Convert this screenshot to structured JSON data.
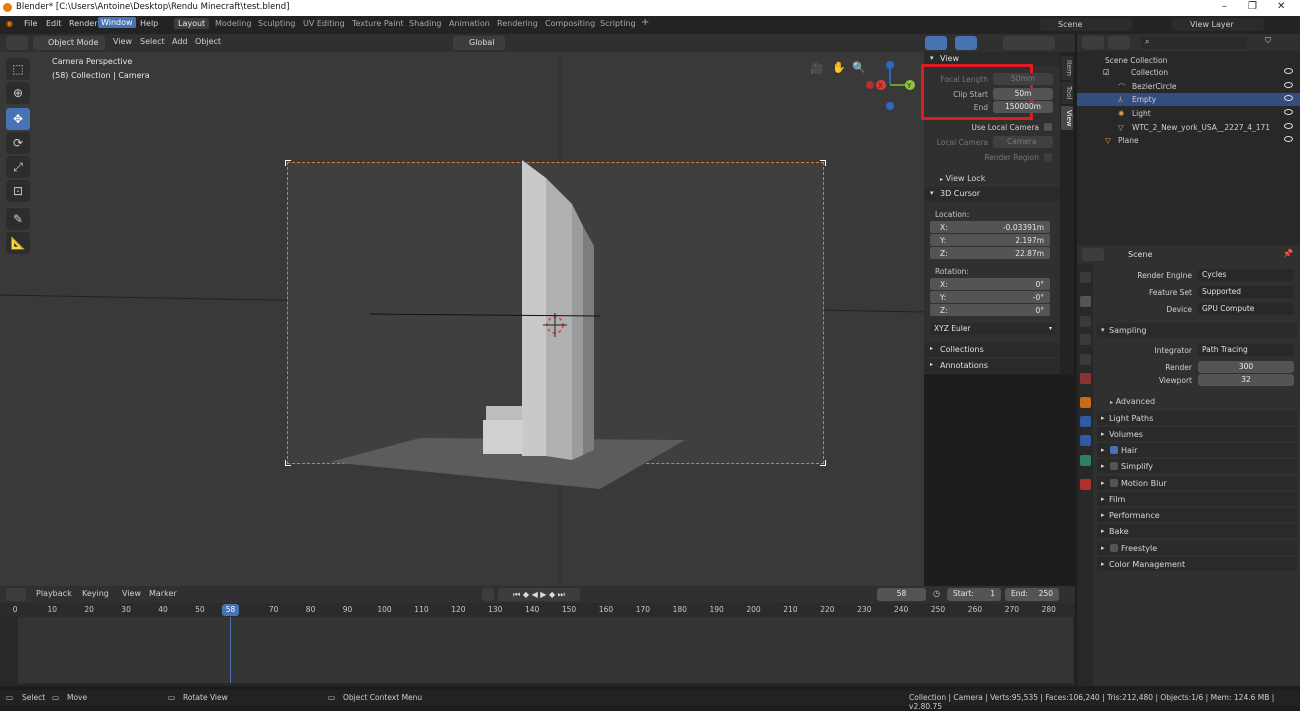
{
  "title": "Blender* [C:\\Users\\Antoine\\Desktop\\Rendu Minecraft\\test.blend]",
  "menu": [
    "File",
    "Edit",
    "Render",
    "Window",
    "Help"
  ],
  "menu_selected": "Window",
  "workspaces": [
    "Layout",
    "Modeling",
    "Sculpting",
    "UV Editing",
    "Texture Paint",
    "Shading",
    "Animation",
    "Rendering",
    "Compositing",
    "Scripting"
  ],
  "active_workspace": "Layout",
  "scene_name": "Scene",
  "view_layer": "View Layer",
  "header": {
    "mode": "Object Mode",
    "view": "View",
    "select": "Select",
    "add": "Add",
    "object": "Object",
    "transform": "Global"
  },
  "viewport": {
    "label1": "Camera Perspective",
    "label2": "(58) Collection | Camera"
  },
  "npanel": {
    "view_title": "View",
    "focal_length_label": "Focal Length",
    "focal_length": "50mm",
    "clip_start_label": "Clip Start",
    "clip_start": "50m",
    "end_label": "End",
    "end": "150000m",
    "use_local_camera": "Use Local Camera",
    "local_camera_label": "Local Camera",
    "local_camera": "Camera",
    "render_region": "Render Region",
    "view_lock": "View Lock",
    "cursor_title": "3D Cursor",
    "location": "Location:",
    "loc_x": "-0.03391m",
    "loc_y": "2.197m",
    "loc_z": "22.87m",
    "rotation": "Rotation:",
    "rot_x": "0°",
    "rot_y": "-0°",
    "rot_z": "0°",
    "euler": "XYZ Euler",
    "collections": "Collections",
    "annotations": "Annotations",
    "tabs": [
      "Item",
      "Tool",
      "View"
    ]
  },
  "outliner": {
    "root": "Scene Collection",
    "items": [
      {
        "label": "Collection"
      },
      {
        "label": "BezierCircle"
      },
      {
        "label": "Empty"
      },
      {
        "label": "Light"
      },
      {
        "label": "WTC_2_New_york_USA__2227_4_1718_tc"
      },
      {
        "label": "Plane"
      }
    ]
  },
  "properties": {
    "context": "Scene",
    "render_engine_label": "Render Engine",
    "render_engine": "Cycles",
    "feature_set_label": "Feature Set",
    "feature_set": "Supported",
    "device_label": "Device",
    "device": "GPU Compute",
    "sampling": "Sampling",
    "integrator_label": "Integrator",
    "integrator": "Path Tracing",
    "render_label": "Render",
    "render": "300",
    "viewport_label": "Viewport",
    "viewport": "32",
    "advanced": "Advanced",
    "sections": [
      "Light Paths",
      "Volumes",
      "Hair",
      "Simplify",
      "Motion Blur",
      "Film",
      "Performance",
      "Bake",
      "Freestyle",
      "Color Management"
    ]
  },
  "timeline": {
    "playback": "Playback",
    "keying": "Keying",
    "view": "View",
    "marker": "Marker",
    "current_frame": "58",
    "start_label": "Start:",
    "start": "1",
    "end_label": "End:",
    "end": "250",
    "ticks": [
      "0",
      "10",
      "20",
      "30",
      "40",
      "50",
      "58",
      "70",
      "80",
      "90",
      "100",
      "110",
      "120",
      "130",
      "140",
      "150",
      "160",
      "170",
      "180",
      "190",
      "200",
      "210",
      "220",
      "230",
      "240",
      "250",
      "260",
      "270",
      "280"
    ]
  },
  "statusbar": {
    "select": "Select",
    "move": "Move",
    "rotate": "Rotate View",
    "context": "Object Context Menu",
    "stats": "Collection | Camera | Verts:95,535 | Faces:106,240 | Tris:212,480 | Objects:1/6 | Mem: 124.6 MB | v2.80.75"
  }
}
